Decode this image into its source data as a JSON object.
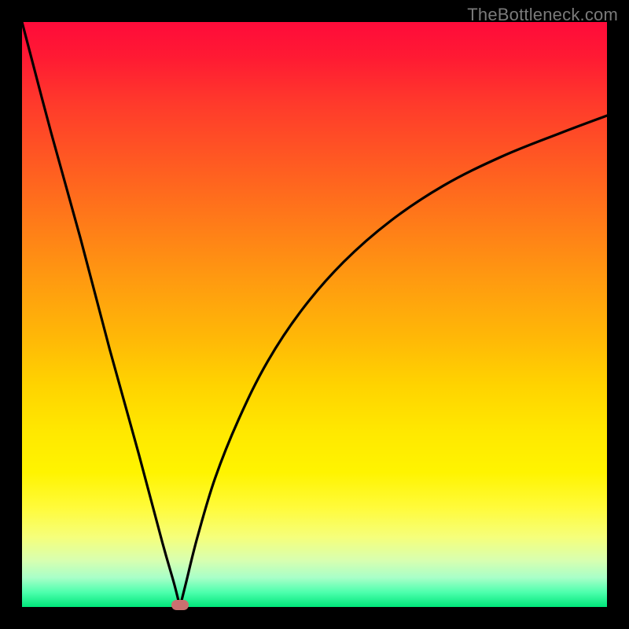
{
  "watermark": "TheBottleneck.com",
  "chart_data": {
    "type": "line",
    "title": "",
    "xlabel": "",
    "ylabel": "",
    "xlim": [
      0,
      100
    ],
    "ylim": [
      0,
      100
    ],
    "grid": false,
    "legend": false,
    "series": [
      {
        "name": "left-branch",
        "x": [
          0,
          5,
          10,
          15,
          20,
          24,
          26,
          27
        ],
        "y": [
          100,
          81,
          63,
          44,
          26,
          11,
          4,
          0
        ]
      },
      {
        "name": "right-branch",
        "x": [
          27,
          28,
          30,
          33,
          37,
          42,
          48,
          55,
          63,
          72,
          82,
          92,
          100
        ],
        "y": [
          0,
          4,
          12,
          22,
          32,
          42,
          51,
          59,
          66,
          72,
          77,
          81,
          84
        ]
      }
    ],
    "minimum_marker": {
      "x": 27,
      "y": 0
    },
    "annotations": []
  },
  "colors": {
    "curve": "#000000",
    "marker": "#c97070",
    "frame": "#000000"
  }
}
